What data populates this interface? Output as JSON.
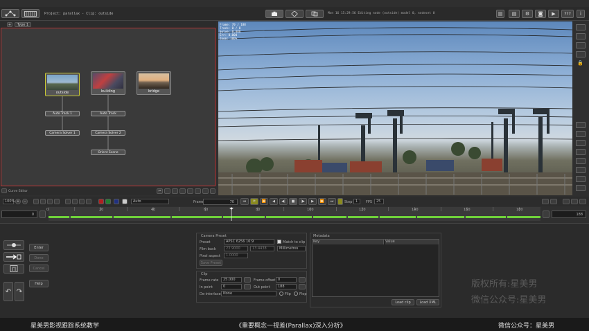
{
  "titlebar": {
    "project_info": "Project: parallax - Clip: outside",
    "status": "Mon 16 15:29:56 Editing node (outside) model 0, nodeset 0",
    "help_label": "???",
    "tab_label": "Type 1"
  },
  "nodes": [
    {
      "label": "outside"
    },
    {
      "label": "building"
    },
    {
      "label": "bridge"
    }
  ],
  "pills": [
    {
      "label": "Auto Track 1"
    },
    {
      "label": "Auto Track"
    },
    {
      "label": "Camera Solver 1"
    },
    {
      "label": "Camera Solver 2"
    },
    {
      "label": "Orient Scene"
    }
  ],
  "viewer": {
    "overlay_lines": [
      "Frame: 70 / 188",
      "Track: 0 / 0",
      "Solve: 0.000",
      "Err: 0.000",
      "Zoom: 100%"
    ]
  },
  "left_toolbar": {
    "curve_editor_label": "Curve Editor",
    "zoom_label": "100%",
    "auto_select": "Auto"
  },
  "playback": {
    "frame_label": "Frame",
    "frame_value": "70",
    "step_label": "Step",
    "step_value": "1",
    "fps_label": "FPS",
    "fps_value": "25"
  },
  "timeline": {
    "ticks": [
      "0",
      "20",
      "40",
      "60",
      "80",
      "100",
      "120",
      "140",
      "160",
      "180"
    ],
    "start_value": "0",
    "end_value": "188"
  },
  "left_panel": {
    "buttons": [
      "Enter",
      "Done",
      "Cancel",
      "Help"
    ]
  },
  "camera_preset": {
    "section": "Camera Preset",
    "preset_label": "Preset",
    "preset_value": "APSC 6256 16:9",
    "match_clip": "Match to clip",
    "filmback_label": "Film back",
    "filmback_w": "23.9000",
    "filmback_h": "13.4438",
    "units": "Millimetres",
    "pixel_aspect_label": "Pixel aspect",
    "pixel_aspect_value": "1.0000",
    "save_preset": "Save Preset"
  },
  "clip": {
    "section": "Clip",
    "frame_rate_label": "Frame rate",
    "frame_rate_value": "25.000",
    "frame_offset_label": "Frame offset",
    "frame_offset_value": "0",
    "in_point_label": "In point",
    "in_point_value": "0",
    "out_point_label": "Out point",
    "out_point_value": "188",
    "deinterlace_label": "De-interlace",
    "deinterlace_value": "None",
    "flip_label": "Flip",
    "flop_label": "Flop"
  },
  "metadata": {
    "section": "Metadata",
    "col_key": "Key",
    "col_value": "Value",
    "load_clip": "Load clip",
    "load_xml": "Load XML"
  },
  "watermark": {
    "line1": "版权所有:星美男",
    "line2": "微信公众号:星美男"
  },
  "caption": {
    "left": "星美男影视跟踪系统教学",
    "center": "《重要概念一视差(Parallax)深入分析》",
    "right": "微信公众号：星美男"
  },
  "colors": {
    "accent_green": "#6fd23a",
    "node_selected": "#c8c832",
    "background": "#2f2f2f"
  }
}
